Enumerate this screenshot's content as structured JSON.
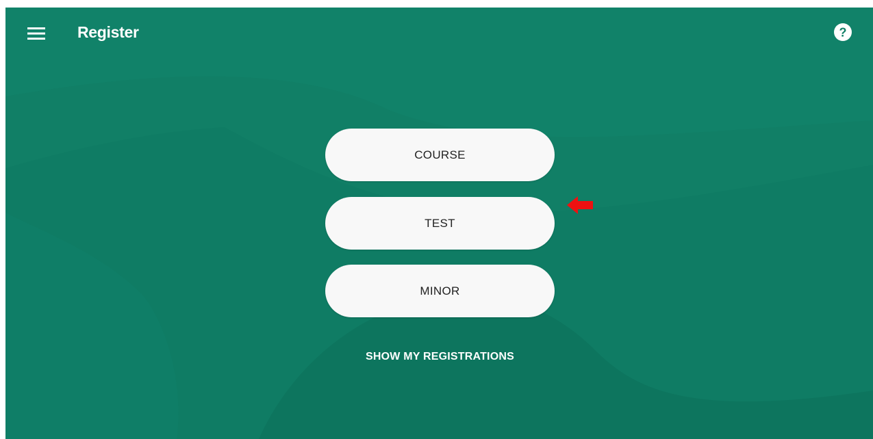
{
  "app": {
    "title": "Register"
  },
  "icons": {
    "menu": "menu-icon",
    "help": "help-icon",
    "arrow": "arrow-left-icon"
  },
  "options": [
    {
      "label": "COURSE"
    },
    {
      "label": "TEST"
    },
    {
      "label": "MINOR"
    }
  ],
  "links": {
    "show_registrations": "SHOW MY REGISTRATIONS"
  },
  "colors": {
    "background": "#117f66",
    "button": "#f8f8f8",
    "arrow": "#ee1111"
  }
}
